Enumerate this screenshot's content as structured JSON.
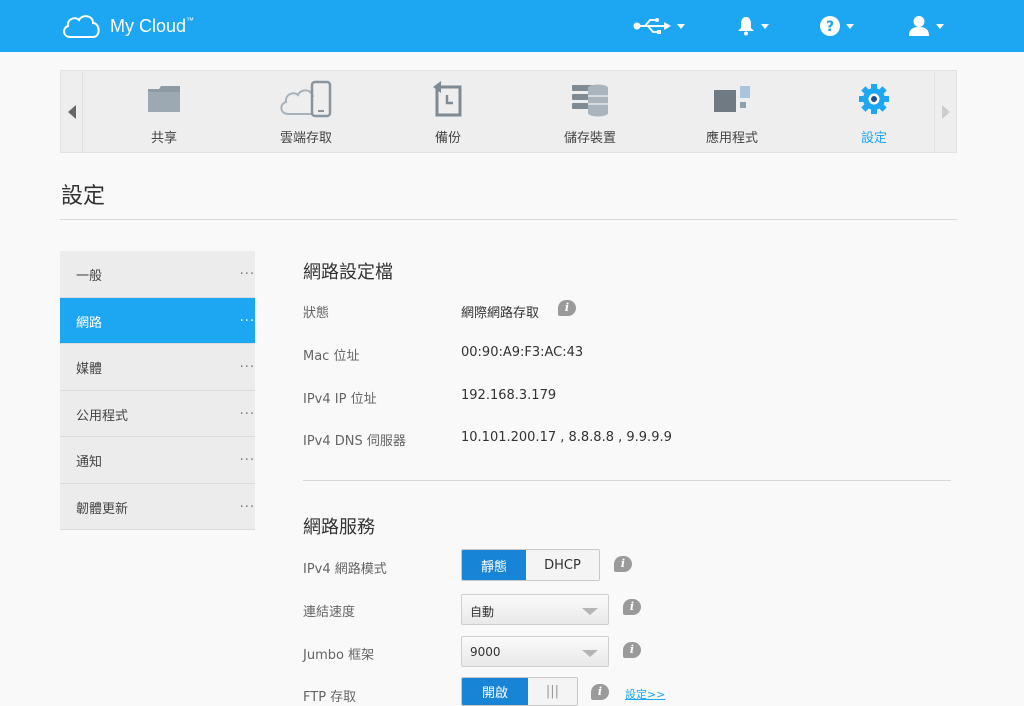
{
  "header": {
    "app_name": "My Cloud",
    "trademark": "™",
    "icons": [
      "usb-icon",
      "bell-icon",
      "help-icon",
      "user-icon"
    ]
  },
  "nav": {
    "items": [
      {
        "label": "共享",
        "icon": "folder-icon"
      },
      {
        "label": "雲端存取",
        "icon": "cloud-device-icon"
      },
      {
        "label": "備份",
        "icon": "backup-icon"
      },
      {
        "label": "儲存裝置",
        "icon": "storage-icon"
      },
      {
        "label": "應用程式",
        "icon": "apps-icon"
      },
      {
        "label": "設定",
        "icon": "gear-icon"
      }
    ],
    "active": "設定"
  },
  "page": {
    "title": "設定"
  },
  "sidebar": {
    "items": [
      {
        "label": "一般",
        "dots": "..."
      },
      {
        "label": "網路",
        "dots": "..."
      },
      {
        "label": "媒體",
        "dots": "..."
      },
      {
        "label": "公用程式",
        "dots": "..."
      },
      {
        "label": "通知",
        "dots": "..."
      },
      {
        "label": "韌體更新",
        "dots": "..."
      }
    ],
    "active": "網路"
  },
  "profile": {
    "title": "網路設定檔",
    "status_label": "狀態",
    "status_value": "網際網路存取",
    "mac_label": "Mac 位址",
    "mac_value": "00:90:A9:F3:AC:43",
    "ip_label": "IPv4 IP 位址",
    "ip_value": "192.168.3.179",
    "dns_label": "IPv4 DNS 伺服器",
    "dns_value": "10.101.200.17 , 8.8.8.8 , 9.9.9.9"
  },
  "services": {
    "title": "網路服務",
    "mode_label": "IPv4 網路模式",
    "mode_static": "靜態",
    "mode_dhcp": "DHCP",
    "speed_label": "連結速度",
    "speed_value": "自動",
    "jumbo_label": "Jumbo 框架",
    "jumbo_value": "9000",
    "ftp_label": "FTP 存取",
    "ftp_on": "開啟",
    "ftp_off": "|||",
    "ftp_link": "設定>>"
  },
  "colors": {
    "accent": "#1da6f2",
    "toggle_on": "#1784d6"
  }
}
